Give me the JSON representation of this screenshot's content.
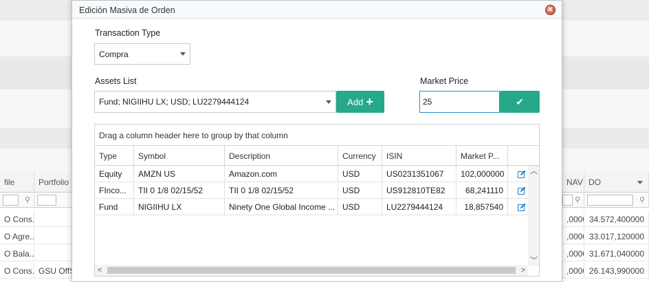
{
  "background": {
    "headers": [
      "file",
      "Portfolio",
      "NAV",
      "DO"
    ],
    "rows": [
      {
        "c0": "O Cons...",
        "c1": "",
        "c2": ",0000",
        "c3": "34.572,400000"
      },
      {
        "c0": "O Agre...",
        "c1": "",
        "c2": ",0000",
        "c3": "33.017,120000"
      },
      {
        "c0": "O Bala...",
        "c1": "",
        "c2": ",0000",
        "c3": "31.671,040000"
      },
      {
        "c0": "O Cons...",
        "c1": "GSU OffS...",
        "c2": ",0000",
        "c3": "26.143,990000"
      }
    ]
  },
  "modal": {
    "title": "Edición Masiva de Orden",
    "transaction_type_label": "Transaction Type",
    "transaction_type_value": "Compra",
    "assets_list_label": "Assets List",
    "assets_list_value": "Fund; NIGIIHU LX; USD; LU2279444124",
    "add_button_label": "Add",
    "add_button_icon": "+",
    "market_price_label": "Market Price",
    "market_price_value": "25",
    "confirm_icon": "✔"
  },
  "grid": {
    "group_panel_text": "Drag a column header here to group by that column",
    "columns": [
      "Type",
      "Symbol",
      "Description",
      "Currency",
      "ISIN",
      "Market P..."
    ],
    "rows": [
      {
        "type": "Equity",
        "symbol": "AMZN US",
        "description": "Amazon.com",
        "currency": "USD",
        "isin": "US0231351067",
        "market_price": "102,000000"
      },
      {
        "type": "FInco...",
        "symbol": "TII 0 1/8 02/15/52",
        "description": "TII 0 1/8 02/15/52",
        "currency": "USD",
        "isin": "US912810TE82",
        "market_price": "68,241110"
      },
      {
        "type": "Fund",
        "symbol": "NIGIIHU LX",
        "description": "Ninety One Global Income ...",
        "currency": "USD",
        "isin": "LU2279444124",
        "market_price": "18,857540"
      }
    ]
  },
  "colors": {
    "accent": "#26a88a",
    "focus": "#2a8fc8",
    "edit_icon": "#1e7fc8"
  }
}
